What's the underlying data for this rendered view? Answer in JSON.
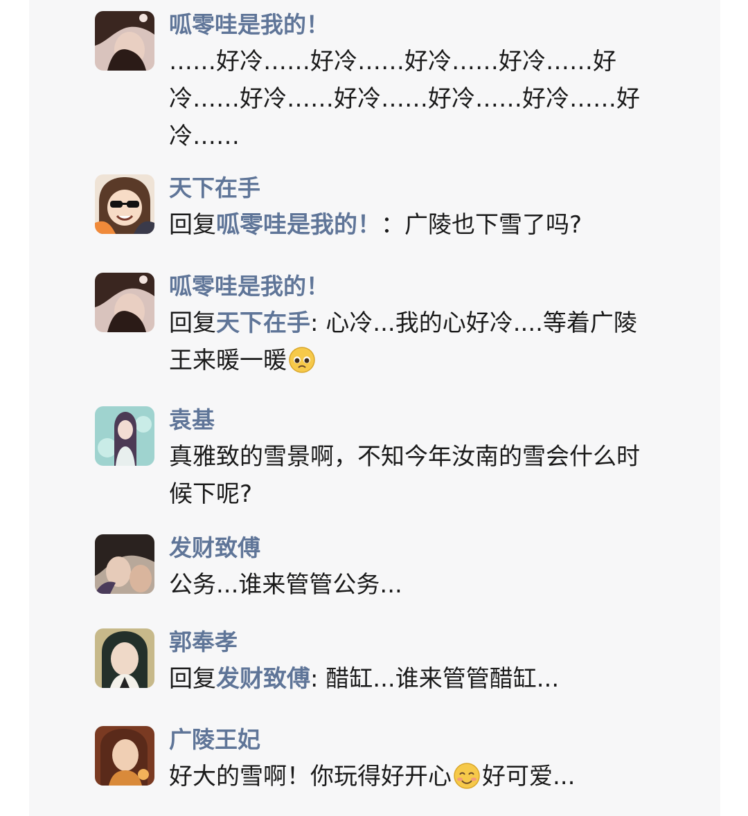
{
  "comments": [
    {
      "username": "呱零哇是我的！",
      "text": "……好冷……好冷……好冷……好冷……好冷……好冷……好冷……好冷……好冷……好冷……"
    },
    {
      "username": "天下在手",
      "reply_prefix": "回复",
      "reply_to": "呱零哇是我的！",
      "reply_sep": "：",
      "text": "广陵也下雪了吗?"
    },
    {
      "username": "呱零哇是我的！",
      "reply_prefix": "回复",
      "reply_to": "天下在手",
      "reply_sep": ":",
      "text": "心冷...我的心好冷....等着广陵王来暖一暖",
      "emoji": "pleading-face-emoji"
    },
    {
      "username": "袁基",
      "text": "真雅致的雪景啊，不知今年汝南的雪会什么时候下呢?"
    },
    {
      "username": "发财致傅",
      "text": "公务...谁来管管公务..."
    },
    {
      "username": "郭奉孝",
      "reply_prefix": "回复",
      "reply_to": "发财致傅",
      "reply_sep": ":",
      "text": "醋缸...谁来管管醋缸..."
    },
    {
      "username": "广陵王妃",
      "text_before": "好大的雪啊！你玩得好开心",
      "emoji": "smiling-face-emoji",
      "text_after": "好可爱..."
    }
  ],
  "colors": {
    "username": "#5f7598",
    "text": "#1a1a1a",
    "panel_background": "#f7f7f8"
  }
}
